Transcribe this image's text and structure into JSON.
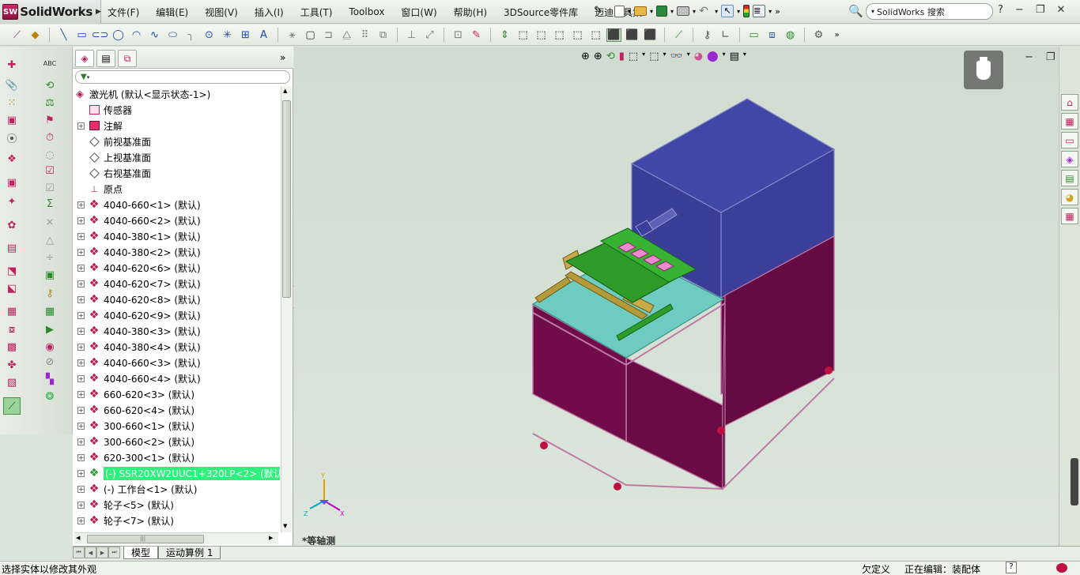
{
  "app": {
    "logo_text": "SolidWorks",
    "logo_badge": "SW"
  },
  "menu": [
    "文件(F)",
    "编辑(E)",
    "视图(V)",
    "插入(I)",
    "工具(T)",
    "Toolbox",
    "窗口(W)",
    "帮助(H)",
    "3DSource零件库",
    "迈迪工具集"
  ],
  "quick_overflow": "»",
  "search": {
    "label": "SolidWorks 搜索",
    "help": "?"
  },
  "feature_tree": {
    "root": "激光机  (默认<显示状态-1>)",
    "filter_icon": "funnel-icon",
    "items": [
      {
        "label": "传感器",
        "expand": false,
        "icon": "sensor"
      },
      {
        "label": "注解",
        "expand": true,
        "icon": "annotation"
      },
      {
        "label": "前视基准面",
        "expand": false,
        "icon": "plane"
      },
      {
        "label": "上视基准面",
        "expand": false,
        "icon": "plane"
      },
      {
        "label": "右视基准面",
        "expand": false,
        "icon": "plane"
      },
      {
        "label": "原点",
        "expand": false,
        "icon": "origin"
      },
      {
        "label": "4040-660<1> (默认)",
        "expand": true,
        "icon": "part"
      },
      {
        "label": "4040-660<2> (默认)",
        "expand": true,
        "icon": "part"
      },
      {
        "label": "4040-380<1> (默认)",
        "expand": true,
        "icon": "part"
      },
      {
        "label": "4040-380<2> (默认)",
        "expand": true,
        "icon": "part"
      },
      {
        "label": "4040-620<6> (默认)",
        "expand": true,
        "icon": "part"
      },
      {
        "label": "4040-620<7> (默认)",
        "expand": true,
        "icon": "part"
      },
      {
        "label": "4040-620<8> (默认)",
        "expand": true,
        "icon": "part"
      },
      {
        "label": "4040-620<9> (默认)",
        "expand": true,
        "icon": "part"
      },
      {
        "label": "4040-380<3> (默认)",
        "expand": true,
        "icon": "part"
      },
      {
        "label": "4040-380<4> (默认)",
        "expand": true,
        "icon": "part"
      },
      {
        "label": "4040-660<3> (默认)",
        "expand": true,
        "icon": "part"
      },
      {
        "label": "4040-660<4> (默认)",
        "expand": true,
        "icon": "part"
      },
      {
        "label": "660-620<3> (默认)",
        "expand": true,
        "icon": "part"
      },
      {
        "label": "660-620<4> (默认)",
        "expand": true,
        "icon": "part"
      },
      {
        "label": "300-660<1> (默认)",
        "expand": true,
        "icon": "part"
      },
      {
        "label": "300-660<2> (默认)",
        "expand": true,
        "icon": "part"
      },
      {
        "label": "620-300<1> (默认)",
        "expand": true,
        "icon": "part"
      },
      {
        "label": "(-) SSR20XW2UUC1+320LP<2> (默认<",
        "expand": true,
        "icon": "part-green",
        "selected": true
      },
      {
        "label": "(-) 工作台<1> (默认)",
        "expand": true,
        "icon": "part"
      },
      {
        "label": "轮子<5> (默认)",
        "expand": true,
        "icon": "part"
      },
      {
        "label": "轮子<7> (默认)",
        "expand": true,
        "icon": "part"
      }
    ]
  },
  "hscroll_grip": "|||",
  "bottom_tabs": [
    "模型",
    "运动算例 1"
  ],
  "view_label": "*等轴测",
  "triad": {
    "x": "X",
    "y": "Y",
    "z": "Z"
  },
  "status": {
    "left": "选择实体以修改其外观",
    "underdefined": "欠定义",
    "editing": "正在编辑：装配体",
    "help": "?"
  },
  "colors": {
    "chassis": "#6a0b45",
    "cabinet": "#3c3f9a",
    "table_top": "#6ecbc1",
    "plate": "#2f9c2a",
    "slider": "#b59a3a",
    "selection": "#2ef07a"
  }
}
